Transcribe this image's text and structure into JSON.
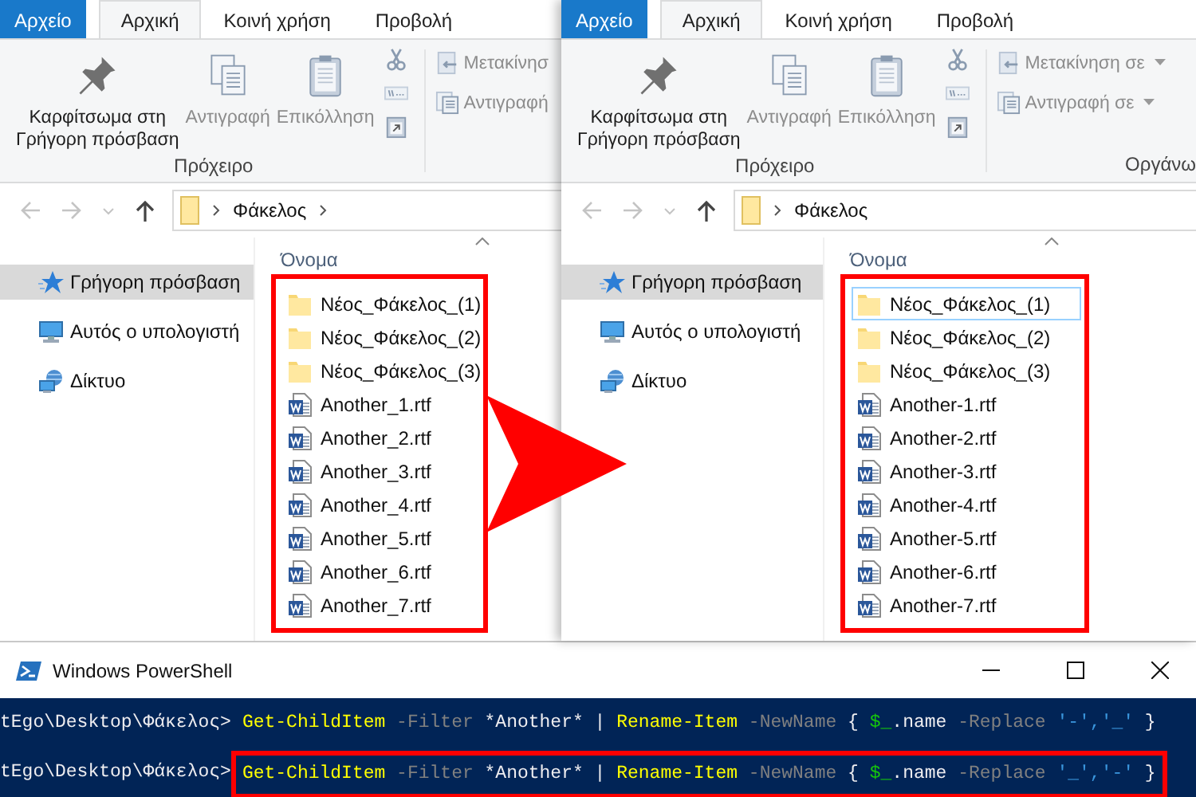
{
  "windows": [
    {
      "tabs": [
        {
          "label": "Αρχείο",
          "kind": "file",
          "selected": false
        },
        {
          "label": "Αρχική",
          "kind": "tab",
          "selected": true
        },
        {
          "label": "Κοινή χρήση",
          "kind": "tab",
          "selected": false
        },
        {
          "label": "Προβολή",
          "kind": "tab",
          "selected": false
        }
      ],
      "clipboard": {
        "buttons": [
          {
            "label": "Καρφίτσωμα στη\nΓρήγορη πρόσβαση",
            "kind": "pin",
            "disabled": false
          },
          {
            "label": "Αντιγραφή",
            "kind": "copy",
            "disabled": true
          },
          {
            "label": "Επικόλληση",
            "kind": "paste",
            "disabled": true
          }
        ],
        "group_label": "Πρόχειρο"
      },
      "organize": {
        "buttons": [
          {
            "label": "Μετακίνησ",
            "kind": "move",
            "dropdown": false
          },
          {
            "label": "Αντιγραφή",
            "kind": "copy_to",
            "dropdown": false
          }
        ]
      },
      "address": {
        "segments": [
          "Φάκελος"
        ],
        "trailing_chevron": true
      },
      "nav": [
        {
          "label": "Γρήγορη πρόσβαση",
          "kind": "star",
          "selected": true
        },
        {
          "label": "Αυτός ο υπολογιστή",
          "kind": "computer",
          "selected": false
        },
        {
          "label": "Δίκτυο",
          "kind": "network",
          "selected": false
        }
      ],
      "column": "Όνομα",
      "files": [
        {
          "name": "Νέος_Φάκελος_(1)",
          "kind": "folder",
          "selected": false
        },
        {
          "name": "Νέος_Φάκελος_(2)",
          "kind": "folder",
          "selected": false
        },
        {
          "name": "Νέος_Φάκελος_(3)",
          "kind": "folder",
          "selected": false
        },
        {
          "name": "Another_1.rtf",
          "kind": "doc",
          "selected": false
        },
        {
          "name": "Another_2.rtf",
          "kind": "doc",
          "selected": false
        },
        {
          "name": "Another_3.rtf",
          "kind": "doc",
          "selected": false
        },
        {
          "name": "Another_4.rtf",
          "kind": "doc",
          "selected": false
        },
        {
          "name": "Another_5.rtf",
          "kind": "doc",
          "selected": false
        },
        {
          "name": "Another_6.rtf",
          "kind": "doc",
          "selected": false
        },
        {
          "name": "Another_7.rtf",
          "kind": "doc",
          "selected": false
        }
      ]
    },
    {
      "tabs": [
        {
          "label": "Αρχείο",
          "kind": "file",
          "selected": false
        },
        {
          "label": "Αρχική",
          "kind": "tab",
          "selected": true
        },
        {
          "label": "Κοινή χρήση",
          "kind": "tab",
          "selected": false
        },
        {
          "label": "Προβολή",
          "kind": "tab",
          "selected": false
        }
      ],
      "clipboard": {
        "buttons": [
          {
            "label": "Καρφίτσωμα στη\nΓρήγορη πρόσβαση",
            "kind": "pin",
            "disabled": false
          },
          {
            "label": "Αντιγραφή",
            "kind": "copy",
            "disabled": true
          },
          {
            "label": "Επικόλληση",
            "kind": "paste",
            "disabled": true
          }
        ],
        "group_label": "Πρόχειρο"
      },
      "organize": {
        "buttons": [
          {
            "label": "Μετακίνηση σε",
            "kind": "move",
            "dropdown": true
          },
          {
            "label": "Αντιγραφή σε",
            "kind": "copy_to",
            "dropdown": true
          }
        ],
        "group_label": "Οργάνω"
      },
      "address": {
        "segments": [
          "Φάκελος"
        ],
        "trailing_chevron": false
      },
      "nav": [
        {
          "label": "Γρήγορη πρόσβαση",
          "kind": "star",
          "selected": true
        },
        {
          "label": "Αυτός ο υπολογιστή",
          "kind": "computer",
          "selected": false
        },
        {
          "label": "Δίκτυο",
          "kind": "network",
          "selected": false
        }
      ],
      "column": "Όνομα",
      "files": [
        {
          "name": "Νέος_Φάκελος_(1)",
          "kind": "folder",
          "selected": true
        },
        {
          "name": "Νέος_Φάκελος_(2)",
          "kind": "folder",
          "selected": false
        },
        {
          "name": "Νέος_Φάκελος_(3)",
          "kind": "folder",
          "selected": false
        },
        {
          "name": "Another-1.rtf",
          "kind": "doc",
          "selected": false
        },
        {
          "name": "Another-2.rtf",
          "kind": "doc",
          "selected": false
        },
        {
          "name": "Another-3.rtf",
          "kind": "doc",
          "selected": false
        },
        {
          "name": "Another-4.rtf",
          "kind": "doc",
          "selected": false
        },
        {
          "name": "Another-5.rtf",
          "kind": "doc",
          "selected": false
        },
        {
          "name": "Another-6.rtf",
          "kind": "doc",
          "selected": false
        },
        {
          "name": "Another-7.rtf",
          "kind": "doc",
          "selected": false
        }
      ]
    }
  ],
  "powershell": {
    "title": "Windows PowerShell",
    "lines": [
      {
        "prompt": "tEgo\\Desktop\\Φάκελος>",
        "highlighted": false,
        "tokens": [
          {
            "text": "Get-ChildItem",
            "kind": "command"
          },
          {
            "text": " -Filter",
            "kind": "parameter"
          },
          {
            "text": " *Another* | ",
            "kind": "plain"
          },
          {
            "text": "Rename-Item",
            "kind": "command"
          },
          {
            "text": " -NewName",
            "kind": "parameter"
          },
          {
            "text": " { ",
            "kind": "plain"
          },
          {
            "text": "$_",
            "kind": "variable"
          },
          {
            "text": ".name",
            "kind": "plain"
          },
          {
            "text": " -Replace",
            "kind": "parameter"
          },
          {
            "text": " '-','_'",
            "kind": "string"
          },
          {
            "text": " }",
            "kind": "plain"
          }
        ]
      },
      {
        "prompt": "tEgo\\Desktop\\Φάκελος>",
        "highlighted": true,
        "tokens": [
          {
            "text": "Get-ChildItem",
            "kind": "command"
          },
          {
            "text": " -Filter",
            "kind": "parameter"
          },
          {
            "text": " *Another* | ",
            "kind": "plain"
          },
          {
            "text": "Rename-Item",
            "kind": "command"
          },
          {
            "text": " -NewName",
            "kind": "parameter"
          },
          {
            "text": " { ",
            "kind": "plain"
          },
          {
            "text": "$_",
            "kind": "variable"
          },
          {
            "text": ".name",
            "kind": "plain"
          },
          {
            "text": " -Replace",
            "kind": "parameter"
          },
          {
            "text": " '_','-'",
            "kind": "string"
          },
          {
            "text": " }",
            "kind": "plain"
          }
        ]
      }
    ]
  }
}
